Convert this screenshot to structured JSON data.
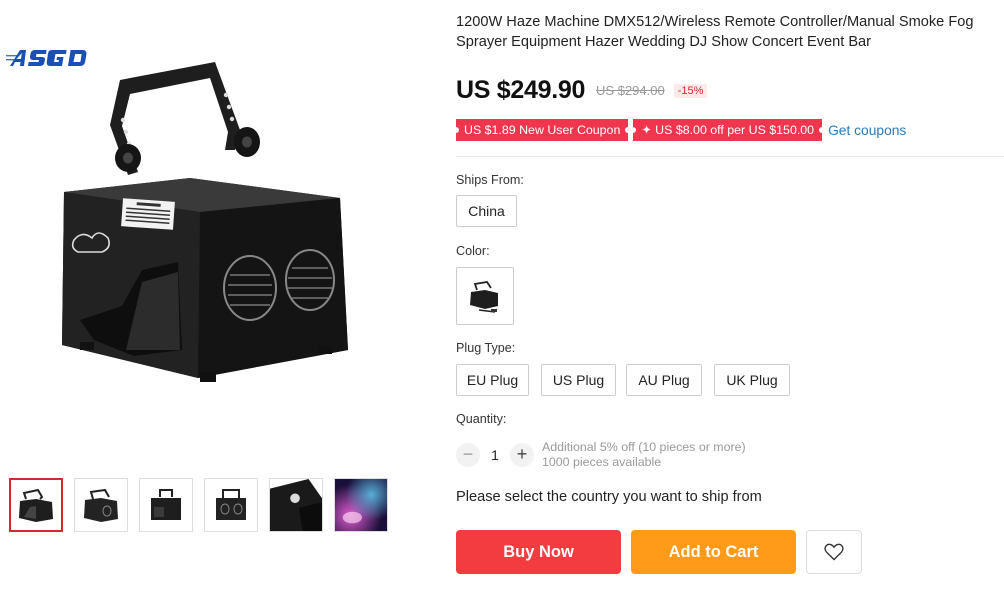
{
  "product": {
    "title": "1200W Haze Machine DMX512/Wireless Remote Controller/Manual Smoke Fog Sprayer Equipment Hazer Wedding DJ Show Concert Event Bar",
    "price": "US $249.90",
    "original_price": "US $294.00",
    "discount": "-15%"
  },
  "gallery": {
    "brand_logo_text": "ASGD",
    "main_image_icon": "haze-machine-image",
    "thumbnails": [
      {
        "icon": "haze-machine-thumb",
        "selected": true
      },
      {
        "icon": "haze-machine-thumb",
        "selected": false
      },
      {
        "icon": "haze-machine-thumb",
        "selected": false
      },
      {
        "icon": "haze-machine-thumb",
        "selected": false
      },
      {
        "icon": "haze-machine-top-thumb",
        "selected": false
      },
      {
        "icon": "stage-fog-thumb",
        "selected": false
      }
    ]
  },
  "coupons": {
    "new_user": "US $1.89 New User Coupon",
    "store": "US $8.00 off per US $150.00",
    "get_coupons": "Get coupons"
  },
  "ships_from": {
    "label": "Ships From:",
    "options": [
      "China"
    ]
  },
  "color": {
    "label": "Color:",
    "swatch_icon": "haze-machine-swatch"
  },
  "plug_type": {
    "label": "Plug Type:",
    "options": [
      "EU Plug",
      "US Plug",
      "AU Plug",
      "UK Plug"
    ]
  },
  "quantity": {
    "label": "Quantity:",
    "value": "1",
    "minus": "−",
    "plus": "+",
    "note_discount": "Additional 5% off (10 pieces or more)",
    "note_available": "1000 pieces available"
  },
  "shipping_message": "Please select the country you want to ship from",
  "actions": {
    "buy_now": "Buy Now",
    "add_to_cart": "Add to Cart",
    "wishlist_icon": "heart-icon"
  },
  "colors": {
    "price_red": "#d7282f",
    "coupon_red": "#f0364f",
    "buy_now": "#f23c40",
    "add_to_cart": "#ff9b18",
    "link_blue": "#2b7bb9"
  }
}
